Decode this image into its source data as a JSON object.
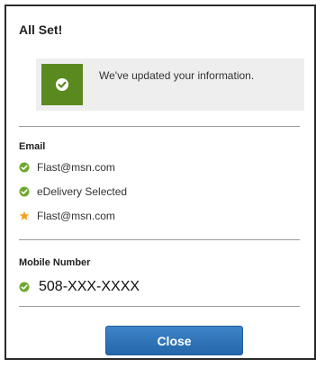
{
  "dialog": {
    "title": "All Set!",
    "banner_message": "We've updated your information."
  },
  "email_section": {
    "label": "Email",
    "items": [
      {
        "text": "Flast@msn.com",
        "icon": "check-icon"
      },
      {
        "text": "eDelivery Selected",
        "icon": "check-icon"
      },
      {
        "text": "Flast@msn.com",
        "icon": "star-icon"
      }
    ]
  },
  "mobile_section": {
    "label": "Mobile Number",
    "value": "508-XXX-XXXX",
    "icon": "check-icon"
  },
  "actions": {
    "close_label": "Close"
  },
  "colors": {
    "success_green": "#5a8a1f",
    "check_green": "#6fa82e",
    "star_orange": "#f2a21b",
    "primary_blue": "#2e74b8"
  }
}
